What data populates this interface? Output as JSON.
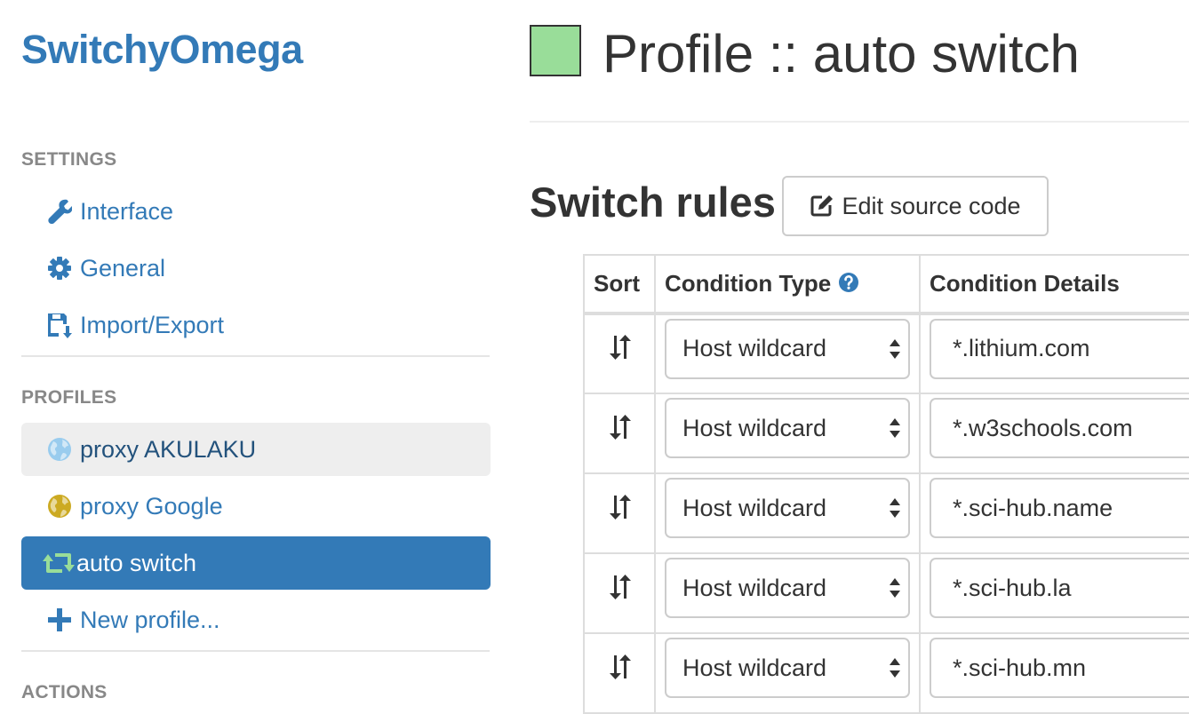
{
  "app": {
    "name": "SwitchyOmega"
  },
  "sidebar": {
    "settings_header": "SETTINGS",
    "settings_items": [
      {
        "label": "Interface",
        "icon": "wrench-icon"
      },
      {
        "label": "General",
        "icon": "gear-icon"
      },
      {
        "label": "Import/Export",
        "icon": "floppy-import-icon"
      }
    ],
    "profiles_header": "PROFILES",
    "profile_items": [
      {
        "label": "proxy AKULAKU",
        "icon": "globe-icon",
        "color": "#99ccee",
        "state": "hovered"
      },
      {
        "label": "proxy Google",
        "icon": "globe-icon",
        "color": "#ccaa22"
      },
      {
        "label": "auto switch",
        "icon": "retweet-icon",
        "color": "#99dd99",
        "state": "active"
      }
    ],
    "new_profile": {
      "label": "New profile...",
      "icon": "plus-icon"
    },
    "actions_header": "ACTIONS"
  },
  "main": {
    "title": "Profile :: auto switch",
    "profile_color": "#99dd99",
    "section_title": "Switch rules",
    "edit_source_label": "Edit source code",
    "table": {
      "columns": [
        "Sort",
        "Condition Type",
        "Condition Details"
      ],
      "rows": [
        {
          "condition_type": "Host wildcard",
          "condition_details": "*.lithium.com"
        },
        {
          "condition_type": "Host wildcard",
          "condition_details": "*.w3schools.com"
        },
        {
          "condition_type": "Host wildcard",
          "condition_details": "*.sci-hub.name"
        },
        {
          "condition_type": "Host wildcard",
          "condition_details": "*.sci-hub.la"
        },
        {
          "condition_type": "Host wildcard",
          "condition_details": "*.sci-hub.mn"
        }
      ]
    }
  },
  "colors": {
    "accent": "#337ab7",
    "active_bg": "#337ab7",
    "hover_bg": "#eeeeee"
  }
}
